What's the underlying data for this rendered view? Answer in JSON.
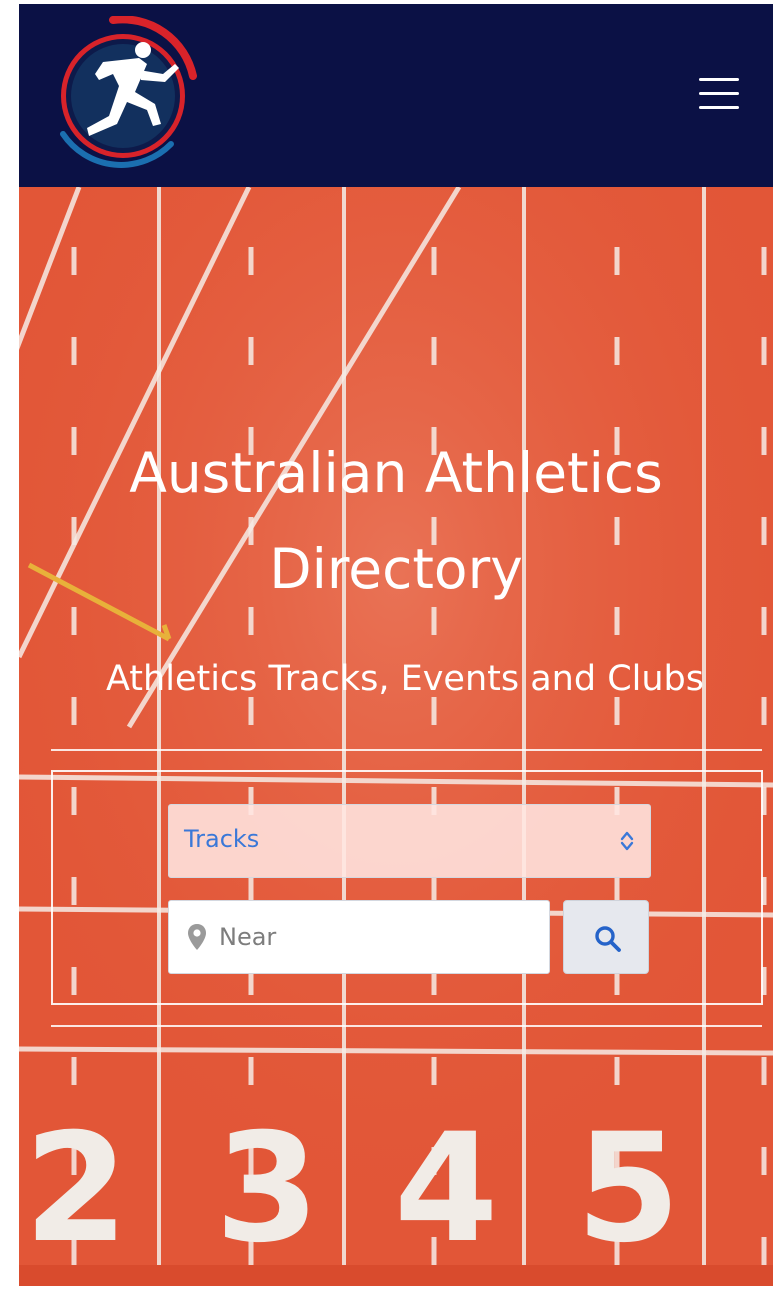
{
  "header": {
    "logo_name": "runner-logo",
    "menu_icon": "hamburger-menu-icon",
    "brand_color": "#0b1145"
  },
  "hero": {
    "title_line1": "Australian Athletics",
    "title_line2": "Directory",
    "subtitle": "Athletics Tracks, Events and Clubs",
    "lane_numbers": [
      "2",
      "3",
      "4",
      "5"
    ],
    "track_color": "#e35a3a"
  },
  "search": {
    "category_selected": "Tracks",
    "near_placeholder": "Near",
    "accent_color": "#3a78d8",
    "search_icon": "search-icon",
    "pin_icon": "location-pin-icon"
  }
}
